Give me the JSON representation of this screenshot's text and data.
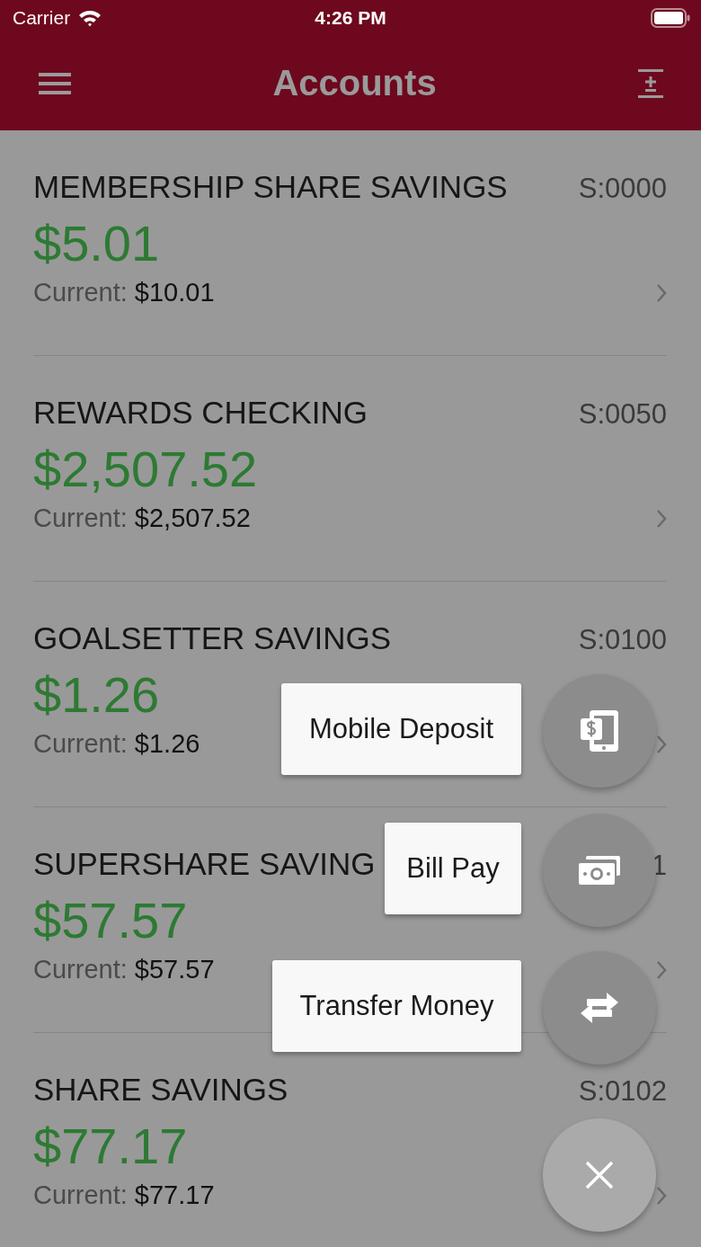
{
  "status_bar": {
    "carrier": "Carrier",
    "time": "4:26 PM"
  },
  "nav": {
    "title": "Accounts"
  },
  "accounts": [
    {
      "name": "MEMBERSHIP SHARE SAVINGS",
      "code": "S:0000",
      "available": "$5.01",
      "current_label": "Current:",
      "current": "$10.01"
    },
    {
      "name": "REWARDS CHECKING",
      "code": "S:0050",
      "available": "$2,507.52",
      "current_label": "Current:",
      "current": "$2,507.52"
    },
    {
      "name": "GOALSETTER SAVINGS",
      "code": "S:0100",
      "available": "$1.26",
      "current_label": "Current:",
      "current": "$1.26"
    },
    {
      "name": "SUPERSHARE SAVING",
      "code": "1",
      "available": "$57.57",
      "current_label": "Current:",
      "current": "$57.57"
    },
    {
      "name": "SHARE SAVINGS",
      "code": "S:0102",
      "available": "$77.17",
      "current_label": "Current:",
      "current": "$77.17"
    }
  ],
  "fab_menu": {
    "expanded": true,
    "actions": [
      {
        "label": "Mobile Deposit",
        "kind": "deposit"
      },
      {
        "label": "Bill Pay",
        "kind": "bill"
      },
      {
        "label": "Transfer Money",
        "kind": "transfer"
      }
    ]
  }
}
